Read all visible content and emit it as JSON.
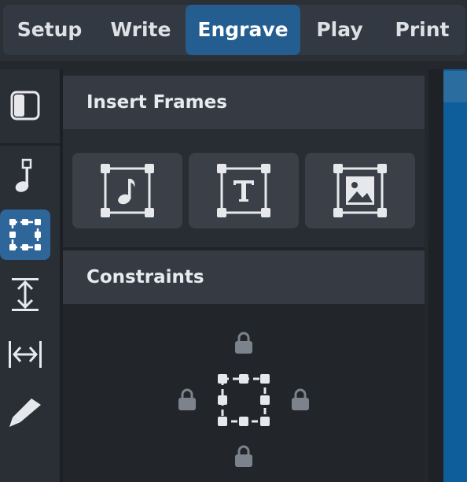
{
  "mode_tabs": [
    {
      "label": "Setup",
      "active": false
    },
    {
      "label": "Write",
      "active": false
    },
    {
      "label": "Engrave",
      "active": true
    },
    {
      "label": "Play",
      "active": false
    },
    {
      "label": "Print",
      "active": false
    }
  ],
  "toolbox": {
    "items": [
      {
        "name": "panel-toggle-icon",
        "active": false
      },
      {
        "name": "graphic-editing-icon",
        "active": false
      },
      {
        "name": "frame-editing-icon",
        "active": true
      },
      {
        "name": "staff-spacing-icon",
        "active": false
      },
      {
        "name": "note-spacing-icon",
        "active": false
      },
      {
        "name": "engrave-pen-icon",
        "active": false
      }
    ]
  },
  "insert_frames": {
    "title": "Insert Frames",
    "buttons": [
      "music-frame-icon",
      "text-frame-icon",
      "graphics-frame-icon"
    ]
  },
  "constraints": {
    "title": "Constraints",
    "locks": [
      "top",
      "left",
      "right",
      "bottom"
    ]
  },
  "colors": {
    "accent": "#245d8f",
    "page_view": "#0f5e9c"
  }
}
